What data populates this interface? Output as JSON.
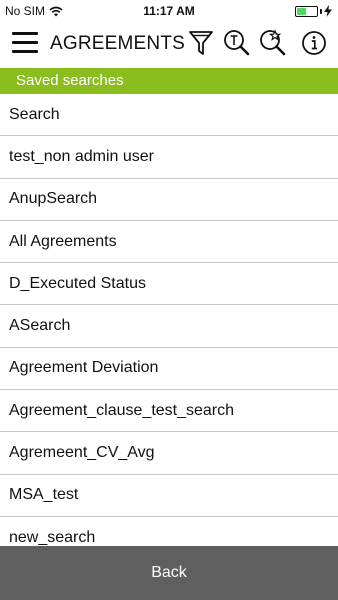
{
  "status_bar": {
    "carrier": "No SIM",
    "time": "11:17 AM",
    "battery_level": 0.45,
    "battery_color": "#4cd964"
  },
  "header": {
    "title": "AGREEMENTS",
    "icons": [
      "menu-icon",
      "filter-icon",
      "text-search-icon",
      "saved-search-icon",
      "info-icon"
    ]
  },
  "section": {
    "label": "Saved searches",
    "color": "#8cbd1f"
  },
  "saved_searches": [
    "Search",
    "test_non admin user",
    "AnupSearch",
    "All Agreements",
    "D_Executed Status",
    "ASearch",
    "Agreement Deviation",
    "Agreement_clause_test_search",
    "Agremeent_CV_Avg",
    "MSA_test",
    "new_search"
  ],
  "footer": {
    "back_label": "Back",
    "color": "#5f5f5f"
  }
}
